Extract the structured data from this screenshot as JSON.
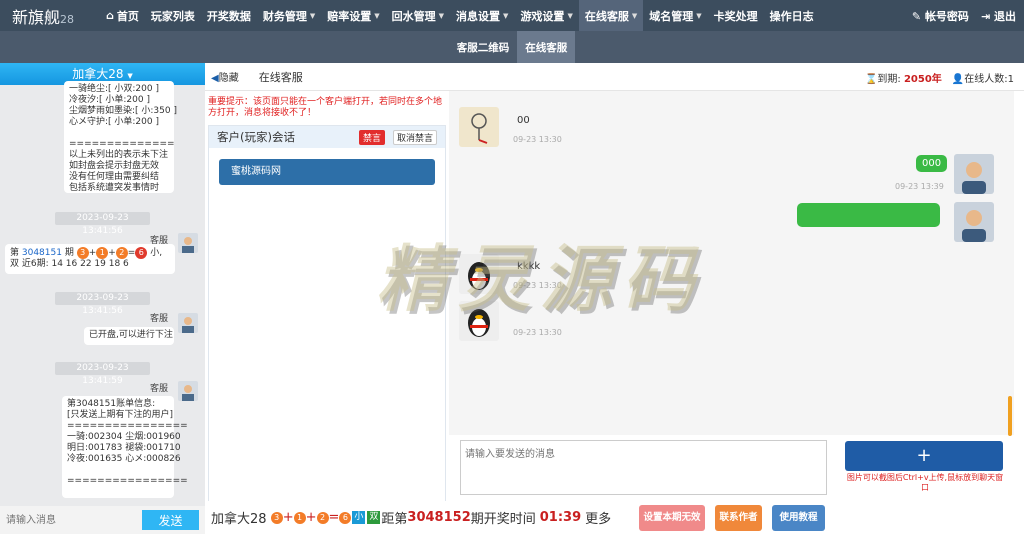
{
  "app": {
    "logo": "新旗舰",
    "logo_suffix": "28"
  },
  "nav": {
    "items": [
      {
        "label": "首页",
        "icon": "home-icon",
        "caret": false
      },
      {
        "label": "玩家列表",
        "caret": false
      },
      {
        "label": "开奖数据",
        "caret": false
      },
      {
        "label": "财务管理",
        "caret": true
      },
      {
        "label": "赔率设置",
        "caret": true
      },
      {
        "label": "回水管理",
        "caret": true
      },
      {
        "label": "消息设置",
        "caret": true
      },
      {
        "label": "游戏设置",
        "caret": true
      },
      {
        "label": "在线客服",
        "caret": true,
        "active": true
      },
      {
        "label": "域名管理",
        "caret": true
      },
      {
        "label": "卡奖处理",
        "caret": false
      },
      {
        "label": "操作日志",
        "caret": false
      }
    ],
    "account": "帐号密码",
    "logout": "退出"
  },
  "subnav": {
    "items": [
      {
        "label": "客服二维码"
      },
      {
        "label": "在线客服",
        "active": true
      }
    ]
  },
  "left": {
    "header": "加拿大28",
    "block1": "一骑绝尘:[ 小双:200 ]\n冷夜汐:[ 小单:200 ]\n尘烟梦雨如墨染:[ 小:350 ]\n心メ守护:[ 小单:200 ]\n\n==============\n以上未列出的表示未下注\n如封盘会提示封盘无效\n没有任何理由需要纠结\n包括系统遭突发事情时",
    "time1": "2023-09-23 13:41:56",
    "sender": "客服",
    "msg2_prefix": "第 ",
    "msg2_period": "3048151",
    "msg2_mid": " 期 ",
    "msg2_balls": [
      "3",
      "1",
      "2"
    ],
    "msg2_sum": "6",
    "msg2_suffix": "小,",
    "msg2_line2": "双 近6期: 14 16 22 19 18 6",
    "time2": "2023-09-23 13:41:56",
    "msg3": "已开盘,可以进行下注",
    "time3": "2023-09-23 13:41:59",
    "block4": "第3048151账单信息:\n[只发送上期有下注的用户]\n================\n一骑:002304 尘烟:001960\n明日:001783 褪袋:001710\n冷夜:001635 心メ:000826\n\n================",
    "input_placeholder": "请输入消息",
    "send": "发送"
  },
  "main": {
    "hide": "隐藏",
    "title": "在线客服",
    "expire_label": "到期:",
    "expire_value": "2050年",
    "online_label": "在线人数:",
    "online_value": "1",
    "warning": "重要提示：该页面只能在一个客户端打开，若同时在多个地方打开，消息将接收不了！",
    "session_title": "客户(玩家)会话",
    "ban": "禁言",
    "unban": "取消禁言",
    "customer": "蜜桃源码网",
    "chat": [
      {
        "text": "00",
        "time": "09-23 13:30"
      },
      {
        "text": "000",
        "time": "09-23 13:39"
      },
      {
        "text": "kkkk",
        "time": "09-23 13:30"
      },
      {
        "text": "",
        "time": "09-23 13:30"
      }
    ],
    "input_placeholder": "请输入要发送的消息",
    "plus": "+",
    "upload_note": "图片可以截图后Ctrl+v上传,鼠标放到聊天窗口",
    "bottom_game": "加拿大28",
    "bottom_balls": [
      "3",
      "1",
      "2"
    ],
    "bottom_sum": "6",
    "bottom_size": "小",
    "bottom_parity": "双",
    "bottom_text1": "距第",
    "bottom_next": "3048152",
    "bottom_text2": "期开奖时间",
    "bottom_countdown": "01:39",
    "bottom_text3": "更多",
    "btn_invalid": "设置本期无效",
    "btn_contact": "联系作者",
    "btn_tutorial": "使用教程",
    "watermark": "精灵源码",
    "colors": {
      "green": "#3aba45",
      "blue": "#1f5ca6",
      "pink": "#f08a8a",
      "orange": "#f0883a",
      "steel": "#4a86c6"
    }
  }
}
